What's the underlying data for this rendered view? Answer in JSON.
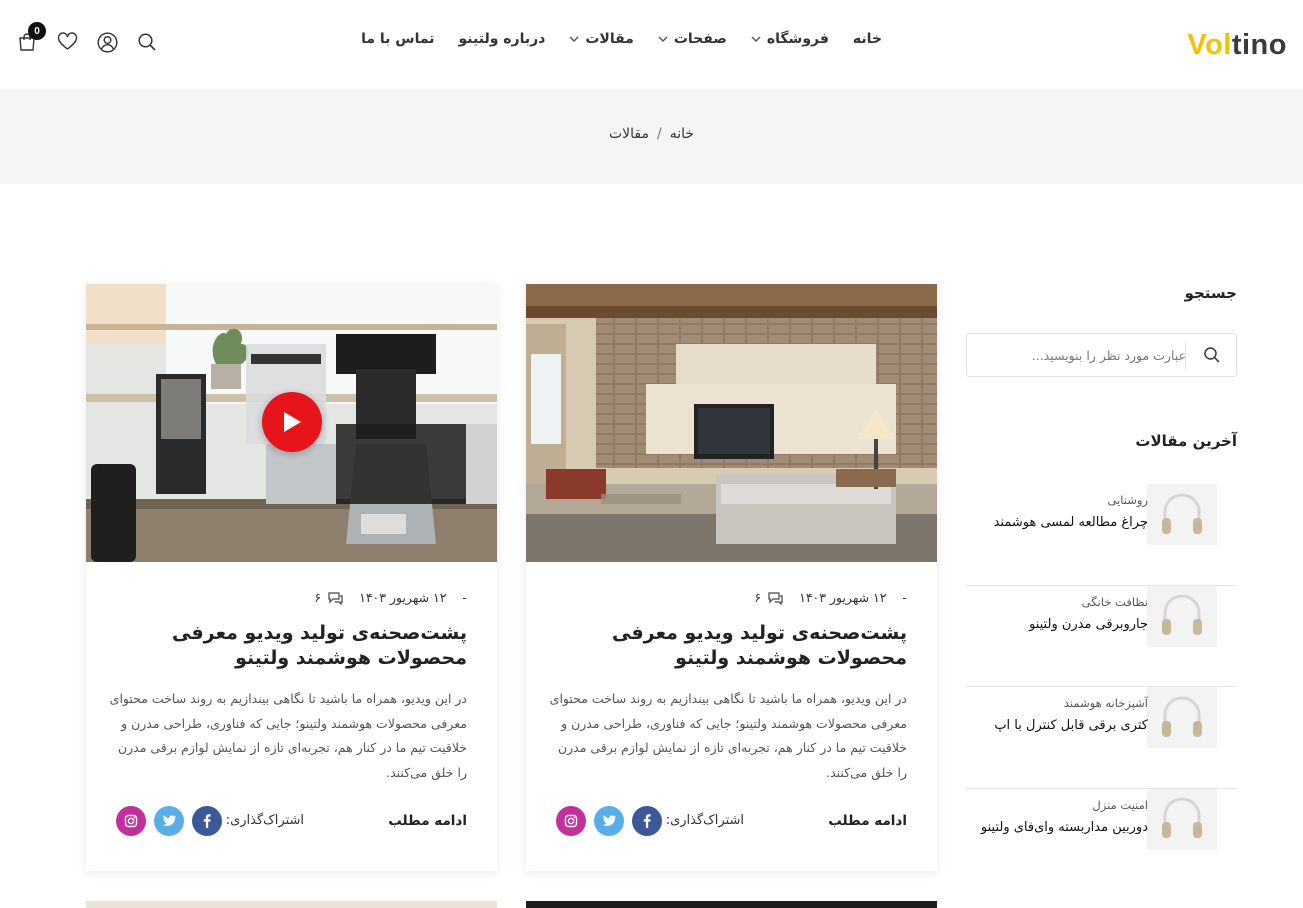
{
  "brand": {
    "logo_part1": "Vol",
    "logo_part2": "tino",
    "accent": "#f2c200"
  },
  "nav": {
    "items": [
      {
        "label": "خانه",
        "has_dropdown": false
      },
      {
        "label": "فروشگاه",
        "has_dropdown": true
      },
      {
        "label": "صفحات",
        "has_dropdown": true
      },
      {
        "label": "مقالات",
        "has_dropdown": true
      },
      {
        "label": "درباره ولتینو",
        "has_dropdown": false
      },
      {
        "label": "تماس با ما",
        "has_dropdown": false
      }
    ]
  },
  "header_icons": {
    "cart_count": "0",
    "icons": [
      "search-icon",
      "user-icon",
      "heart-icon",
      "cart-icon"
    ]
  },
  "breadcrumb": {
    "home": "خانه",
    "separator": "/",
    "current": "مقالات"
  },
  "sidebar": {
    "search_title": "جستجو",
    "search_placeholder": "عبارت مورد نظر را بنویسید...",
    "latest_title": "آخرین مقالات",
    "posts": [
      {
        "category": "روشنایی",
        "title": "چراغ مطالعه لمسی هوشمند"
      },
      {
        "category": "نظافت خانگی",
        "title": "جاروبرقی مدرن ولتینو"
      },
      {
        "category": "آشپزخانه هوشمند",
        "title": "کتری برقی قابل کنترل با اپ"
      },
      {
        "category": "امنیت منزل",
        "title": "دوربین مداربسته وای‌فای ولتینو"
      }
    ]
  },
  "articles": [
    {
      "date_prefix": "-",
      "date": "۱۲ شهریور ۱۴۰۳",
      "comments": "۶",
      "title": "پشت‌صحنه‌ی تولید ویدیو معرفی محصولات هوشمند ولتینو",
      "excerpt": "در این ویدیو، همراه ما باشید تا نگاهی بیندازیم به روند ساخت محتوای معرفی محصولات هوشمند ولتینو؛ جایی که فناوری، طراحی مدرن و خلاقیت تیم ما در کنار هم، تجربه‌ای تازه از نمایش لوازم برقی مدرن را خلق می‌کنند.",
      "read_more": "ادامه مطلب",
      "share_label": "اشتراک‌گذاری:",
      "image": "living-room-image",
      "has_video": false
    },
    {
      "date_prefix": "-",
      "date": "۱۲ شهریور ۱۴۰۳",
      "comments": "۶",
      "title": "پشت‌صحنه‌ی تولید ویدیو معرفی محصولات هوشمند ولتینو",
      "excerpt": "در این ویدیو، همراه ما باشید تا نگاهی بیندازیم به روند ساخت محتوای معرفی محصولات هوشمند ولتینو؛ جایی که فناوری، طراحی مدرن و خلاقیت تیم ما در کنار هم، تجربه‌ای تازه از نمایش لوازم برقی مدرن را خلق می‌کنند.",
      "read_more": "ادامه مطلب",
      "share_label": "اشتراک‌گذاری:",
      "image": "coffee-maker-image",
      "has_video": true
    }
  ],
  "social_colors": {
    "facebook": "#3b5998",
    "twitter": "#5aaee8",
    "instagram": "#c0319b"
  },
  "play_color": "#e8141b"
}
